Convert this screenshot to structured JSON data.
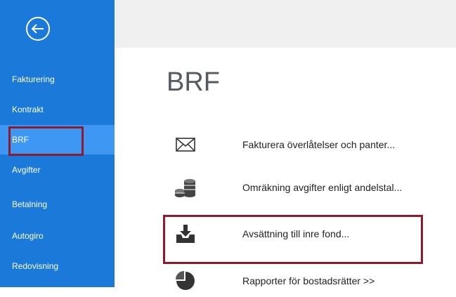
{
  "sidebar": {
    "back_icon": "back-arrow-icon",
    "items": [
      {
        "label": "Fakturering"
      },
      {
        "label": "Kontrakt"
      },
      {
        "label": "BRF"
      },
      {
        "label": "Avgifter"
      },
      {
        "label": "Betalning"
      },
      {
        "label": "Autogiro"
      },
      {
        "label": "Redovisning"
      }
    ],
    "active_index": 2
  },
  "main": {
    "title": "BRF",
    "commands": [
      {
        "label": "Fakturera överlåtelser och panter...",
        "icon": "envelope-icon"
      },
      {
        "label": "Omräkning avgifter enligt andelstal...",
        "icon": "coins-icon"
      },
      {
        "label": "Avsättning till inre fond...",
        "icon": "download-tray-icon"
      },
      {
        "label": "Rapporter för bostadsrätter >>",
        "icon": "pie-chart-icon"
      }
    ]
  },
  "colors": {
    "sidebar": "#1a79d9",
    "sidebar_active": "#3e97f2",
    "highlight": "#8b1b2d",
    "topbar": "#f0f0f0",
    "title": "#555a60"
  }
}
